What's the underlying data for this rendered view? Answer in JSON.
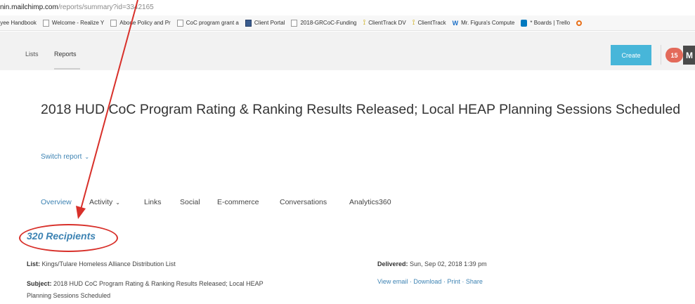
{
  "browser": {
    "url_host": "nin.mailchimp.com",
    "url_path": "/reports/summary?id=3342165",
    "bookmarks": [
      {
        "label": "loyee Handbook",
        "icon": "none"
      },
      {
        "label": "Welcome - Realize Y",
        "icon": "page"
      },
      {
        "label": "Abode Policy and Pr",
        "icon": "page"
      },
      {
        "label": "CoC program grant a",
        "icon": "page"
      },
      {
        "label": "Client Portal",
        "icon": "portal"
      },
      {
        "label": "2018-GRCoC-Funding",
        "icon": "page"
      },
      {
        "label": "ClientTrack DV",
        "icon": "ct"
      },
      {
        "label": "ClientTrack",
        "icon": "ct"
      },
      {
        "label": "Mr. Figura's Compute",
        "icon": "w"
      },
      {
        "label": "* Boards | Trello",
        "icon": "trello"
      }
    ]
  },
  "nav": {
    "lists": "Lists",
    "reports": "Reports",
    "create": "Create",
    "notification_count": "15",
    "avatar_initial": "M"
  },
  "report": {
    "title": "2018 HUD CoC Program Rating & Ranking Results Released; Local HEAP Planning Sessions Scheduled",
    "switch_report": "Switch report",
    "tabs": [
      "Overview",
      "Activity",
      "Links",
      "Social",
      "E-commerce",
      "Conversations",
      "Analytics360"
    ],
    "recipients": "320 Recipients",
    "list_label": "List:",
    "list_value": "Kings/Tulare Homeless Alliance Distribution List",
    "subject_label": "Subject:",
    "subject_value": "2018 HUD CoC Program Rating & Ranking Results Released; Local HEAP",
    "subject_value_2": "Planning Sessions Scheduled",
    "delivered_label": "Delivered:",
    "delivered_value": "Sun, Sep 02, 2018 1:39 pm",
    "links": "View email · Download · Print · Share"
  },
  "colors": {
    "link": "#3d83b3",
    "create_button": "#47b6d9",
    "annotation": "#d8302a",
    "badge": "#e36a5a"
  }
}
